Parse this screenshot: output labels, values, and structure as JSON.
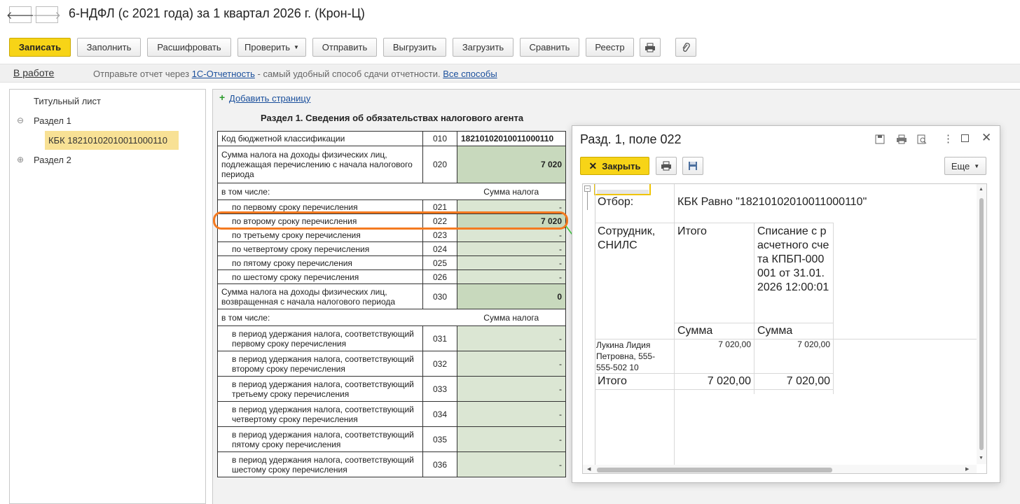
{
  "window": {
    "title": "6-НДФЛ (с 2021 года) за 1 квартал 2026 г. (Крон-Ц)"
  },
  "nav": {
    "back_icon": "arrow-left-icon",
    "forward_icon": "arrow-right-icon"
  },
  "toolbar": {
    "save_label": "Записать",
    "fill_label": "Заполнить",
    "decode_label": "Расшифровать",
    "check_label": "Проверить",
    "send_label": "Отправить",
    "export_label": "Выгрузить",
    "import_label": "Загрузить",
    "compare_label": "Сравнить",
    "registry_label": "Реестр",
    "print_icon": "printer-icon",
    "attach_icon": "paperclip-icon"
  },
  "status": {
    "state": "В работе",
    "text_before": "Отправьте отчет через",
    "link1": "1С-Отчетность",
    "text_middle": "- самый удобный способ сдачи отчетности.",
    "link2": "Все способы"
  },
  "tree": {
    "items": [
      {
        "label": "Титульный лист"
      },
      {
        "label": "Раздел 1",
        "toggle": "⊖"
      },
      {
        "label": "КБК 18210102010011000110"
      },
      {
        "label": "Раздел 2",
        "toggle": "⊕"
      }
    ]
  },
  "form": {
    "add_page": "Добавить страницу",
    "add_icon": "+",
    "section_title": "Раздел 1. Сведения об обязательствах налогового агента",
    "rows": {
      "kbk": {
        "label": "Код бюджетной классификации",
        "code": "010",
        "value": "18210102010011000110"
      },
      "r020": {
        "label": "Сумма налога на доходы физических лиц, подлежащая перечислению с начала налогового периода",
        "code": "020",
        "value": "7 020"
      },
      "incl1": {
        "label": "в том числе:",
        "header": "Сумма налога"
      },
      "r021": {
        "label": "по первому сроку перечисления",
        "code": "021",
        "value": "-"
      },
      "r022": {
        "label": "по второму сроку перечисления",
        "code": "022",
        "value": "7 020"
      },
      "r023": {
        "label": "по третьему сроку перечисления",
        "code": "023",
        "value": "-"
      },
      "r024": {
        "label": "по четвертому сроку перечисления",
        "code": "024",
        "value": "-"
      },
      "r025": {
        "label": "по пятому сроку перечисления",
        "code": "025",
        "value": "-"
      },
      "r026": {
        "label": "по шестому сроку перечисления",
        "code": "026",
        "value": "-"
      },
      "r030": {
        "label": "Сумма налога на доходы физических лиц, возвращенная с начала налогового периода",
        "code": "030",
        "value": "0"
      },
      "incl2": {
        "label": "в том числе:",
        "header": "Сумма налога"
      },
      "r031": {
        "label": "в период удержания налога, соответствующий первому сроку перечисления",
        "code": "031",
        "value": "-"
      },
      "r032": {
        "label": "в период удержания налога, соответствующий второму сроку перечисления",
        "code": "032",
        "value": "-"
      },
      "r033": {
        "label": "в период удержания налога, соответствующий третьему сроку перечисления",
        "code": "033",
        "value": "-"
      },
      "r034": {
        "label": "в период удержания налога, соответствующий четвертому сроку перечисления",
        "code": "034",
        "value": "-"
      },
      "r035": {
        "label": "в период удержания налога, соответствующий пятому сроку перечисления",
        "code": "035",
        "value": "-"
      },
      "r036": {
        "label": "в период удержания налога, соответствующий шестому сроку перечисления",
        "code": "036",
        "value": "-"
      }
    }
  },
  "modal": {
    "title": "Разд. 1, поле 022",
    "close_label": "Закрыть",
    "more_label": "Еще",
    "report": {
      "filter_label": "Отбор:",
      "filter_value": "КБК Равно \"18210102010011000110\"",
      "col1_header": "Сотрудник, СНИЛС",
      "col2_header": "Итого",
      "col3_header": "Списание с расчетного счета КПБП-000001 от 31.01.2026 12:00:01",
      "sub2": "Сумма",
      "sub3": "Сумма",
      "row_employee": "Лукина Лидия Петровна, 555-555-502 10",
      "row_total": "7 020,00",
      "row_value": "7 020,00",
      "total_label": "Итого",
      "total_value": "7 020,00",
      "total_value2": "7 020,00"
    }
  },
  "colors": {
    "accent": "#f7d417",
    "highlight": "#f47a20",
    "arrow": "#3fcf3f",
    "cell_fill": "#dbe6d3"
  }
}
